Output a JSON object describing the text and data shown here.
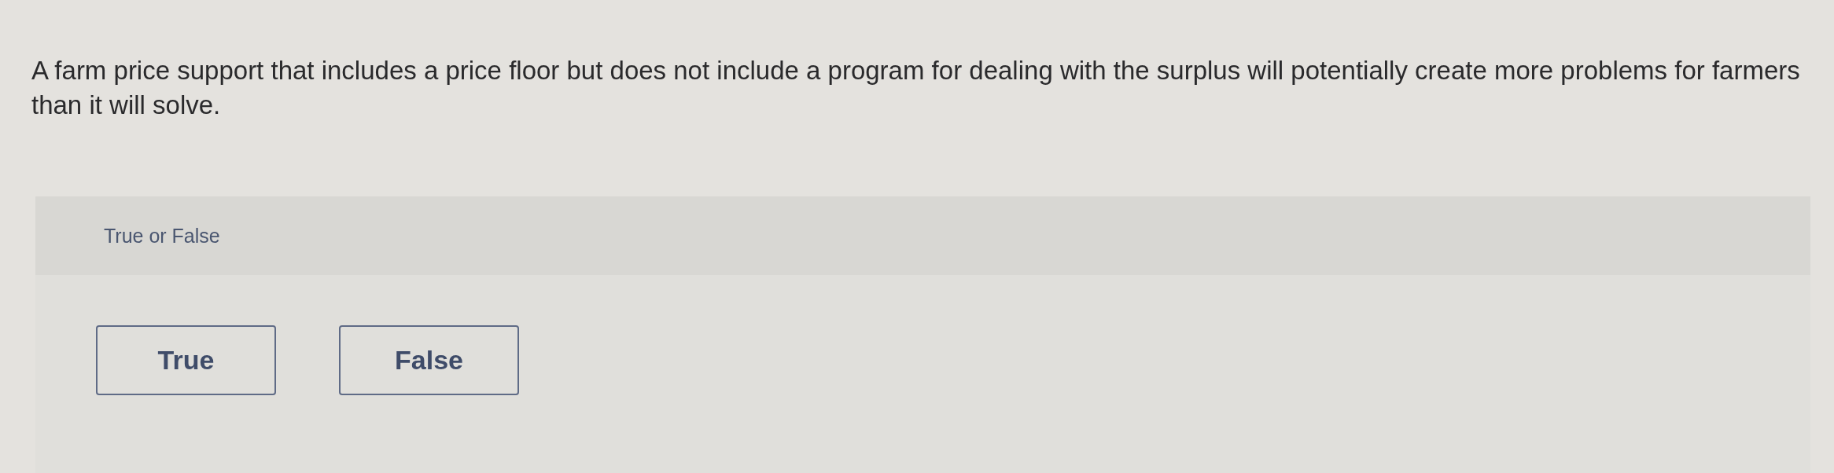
{
  "question": {
    "text": "A farm price support that includes a price floor but does not include a program for dealing with the surplus will potentially create more problems for farmers than it will solve."
  },
  "prompt": {
    "label": "True or False"
  },
  "options": [
    {
      "label": "True",
      "selected": false
    },
    {
      "label": "False",
      "selected": false
    }
  ]
}
